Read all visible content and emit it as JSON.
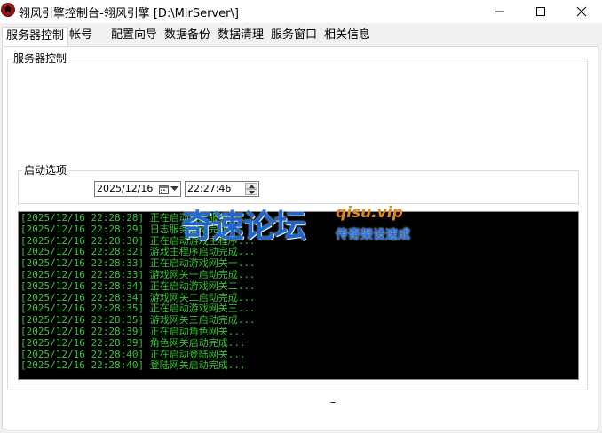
{
  "window": {
    "title": "翎风引擎控制台-翎风引擎 [D:\\MirServer\\]",
    "minimize_icon": "minimize-icon",
    "maximize_icon": "maximize-icon",
    "close_icon": "close-icon"
  },
  "tabs": [
    {
      "label": "服务器控制",
      "active": true
    },
    {
      "label": "帐号",
      "active": false
    },
    {
      "label": "配置向导",
      "active": false
    },
    {
      "label": "数据备份",
      "active": false
    },
    {
      "label": "数据清理",
      "active": false
    },
    {
      "label": "服务窗口",
      "active": false
    },
    {
      "label": "相关信息",
      "active": false
    }
  ],
  "server_control_group": {
    "legend": "服务器控制"
  },
  "startup_options_group": {
    "legend": "启动选项",
    "date_value": "2025/12/16",
    "time_value": "22:27:46"
  },
  "log": [
    {
      "timestamp": "[2025/12/16 22:28:28]",
      "message": "正在启动日志服务..."
    },
    {
      "timestamp": "[2025/12/16 22:28:29]",
      "message": "日志服务启动完成..."
    },
    {
      "timestamp": "[2025/12/16 22:28:30]",
      "message": "正在启动游戏主程序..."
    },
    {
      "timestamp": "[2025/12/16 22:28:32]",
      "message": "游戏主程序启动完成..."
    },
    {
      "timestamp": "[2025/12/16 22:28:33]",
      "message": "正在启动游戏网关一..."
    },
    {
      "timestamp": "[2025/12/16 22:28:33]",
      "message": "游戏网关一启动完成..."
    },
    {
      "timestamp": "[2025/12/16 22:28:34]",
      "message": "正在启动游戏网关二..."
    },
    {
      "timestamp": "[2025/12/16 22:28:34]",
      "message": "游戏网关二启动完成..."
    },
    {
      "timestamp": "[2025/12/16 22:28:35]",
      "message": "正在启动游戏网关三..."
    },
    {
      "timestamp": "[2025/12/16 22:28:35]",
      "message": "游戏网关三启动完成..."
    },
    {
      "timestamp": "[2025/12/16 22:28:39]",
      "message": "正在启动角色网关..."
    },
    {
      "timestamp": "[2025/12/16 22:28:39]",
      "message": "角色网关启动完成..."
    },
    {
      "timestamp": "[2025/12/16 22:28:40]",
      "message": "正在启动登陆网关..."
    },
    {
      "timestamp": "[2025/12/16 22:28:40]",
      "message": "登陆网关启动完成..."
    }
  ],
  "watermark": {
    "main": "奇速论坛",
    "site": "qisu.vip",
    "slogan": "传奇架设速成"
  },
  "status": {
    "text": "–"
  },
  "colors": {
    "log_text": "#36c636",
    "log_bg": "#000000",
    "watermark_blue": "#1f6fe0",
    "watermark_orange": "#e08a1a"
  }
}
